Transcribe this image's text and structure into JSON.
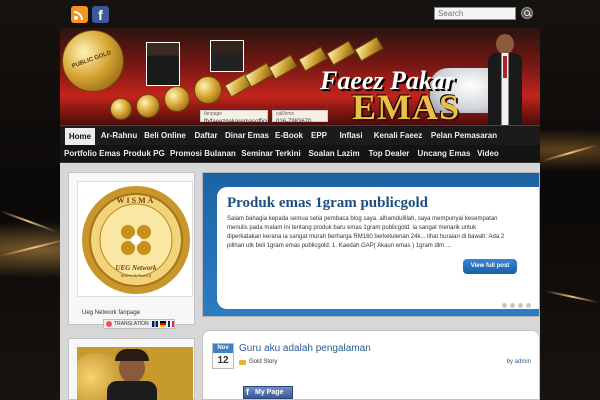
{
  "topbar": {
    "rss_icon": "rss-icon",
    "facebook_icon": "facebook-icon",
    "search": {
      "placeholder": "Search"
    }
  },
  "banner": {
    "brand_line1": "Faeez Pakar",
    "brand_line2": "EMAS",
    "fanpage_label": "fanpage",
    "fanpage_value": "fb/faeezpakaremasofficial",
    "call_label": "call/sms",
    "call_value": "016-7983670",
    "coin_text": "PUBLIC GOLD"
  },
  "nav": {
    "row1": [
      "Home",
      "Ar-Rahnu",
      "Beli Online",
      "Daftar",
      "Dinar Emas",
      "E-Book",
      "EPP",
      "Inflasi",
      "Kenali Faeez",
      "Pelan Pemasaran"
    ],
    "row2": [
      "Portfolio Emas",
      "Produk PG",
      "Promosi Bulanan",
      "Seminar Terkini",
      "Soalan Lazim",
      "Top Dealer",
      "Uncang Emas",
      "Video"
    ],
    "active": "Home"
  },
  "sidebar": {
    "ueg_widget": {
      "seal_top": "WISMA",
      "seal_bottom": "UEG Network",
      "seal_tagline": "Believe In Yourself",
      "label": "Ueg Network fanpage",
      "translation": "TRANSLATION"
    }
  },
  "slider": {
    "title": "Produk emas 1gram publicgold",
    "excerpt": "Salam bahagia kepada semua setia pembaca blog saya. alhamdulillah, saya mempunyai kesempatan menulis pada malam ini tentang produk baru emas 1gram publicgold. ia sangat menarik untuk diperkatakan kerana ia sangat murah berharga RM160 berketulenan 24k... lihat huraian di bawah: Ada 2 pilihan utk beli 1gram emas publicgold: 1. Kaedah GAP( Akaun emas ) 1gram dlm ...",
    "button": "View full post",
    "slide_count": 5,
    "active_slide": 1
  },
  "post": {
    "month": "Nov",
    "day": "12",
    "title": "Guru aku adalah pengalaman",
    "category": "Gold Story",
    "by_label": "by",
    "author": "admin",
    "badge": "My Page"
  },
  "colors": {
    "accent_blue": "#2c7cc4",
    "nav_bg": "#1b1b1b",
    "gold": "#d8a735",
    "banner_red": "#c2241b"
  }
}
